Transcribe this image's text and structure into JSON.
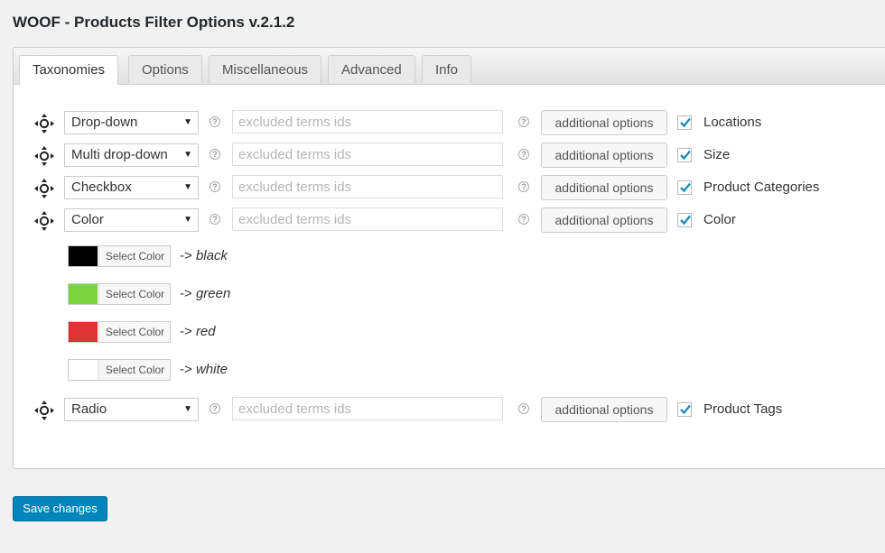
{
  "page_title": "WOOF - Products Filter Options v.2.1.2",
  "tabs": [
    {
      "label": "Taxonomies",
      "active": true
    },
    {
      "label": "Options"
    },
    {
      "label": "Miscellaneous"
    },
    {
      "label": "Advanced"
    },
    {
      "label": "Info"
    }
  ],
  "taxonomy_rows": [
    {
      "type": "Drop-down",
      "excluded_placeholder": "excluded terms ids",
      "button": "additional options",
      "checked": true,
      "label": "Locations"
    },
    {
      "type": "Multi drop-down",
      "excluded_placeholder": "excluded terms ids",
      "button": "additional options",
      "checked": true,
      "label": "Size"
    },
    {
      "type": "Checkbox",
      "excluded_placeholder": "excluded terms ids",
      "button": "additional options",
      "checked": true,
      "label": "Product Categories"
    },
    {
      "type": "Color",
      "excluded_placeholder": "excluded terms ids",
      "button": "additional options",
      "checked": true,
      "label": "Color"
    },
    {
      "type": "Radio",
      "excluded_placeholder": "excluded terms ids",
      "button": "additional options",
      "checked": true,
      "label": "Product Tags"
    }
  ],
  "color_terms": [
    {
      "color": "#000000",
      "button": "Select Color",
      "arrow": "->",
      "term": "black"
    },
    {
      "color": "#7ed43e",
      "button": "Select Color",
      "arrow": "->",
      "term": "green"
    },
    {
      "color": "#dd3333",
      "button": "Select Color",
      "arrow": "->",
      "term": "red"
    },
    {
      "color": "#ffffff",
      "button": "Select Color",
      "arrow": "->",
      "term": "white"
    }
  ],
  "save_label": "Save changes",
  "colors": {
    "accent": "#0085ba",
    "check": "#1e8cbe"
  },
  "icons": {
    "move": "move-icon",
    "help": "help-icon",
    "dropdown": "chevron-down-icon",
    "check": "check-icon"
  }
}
